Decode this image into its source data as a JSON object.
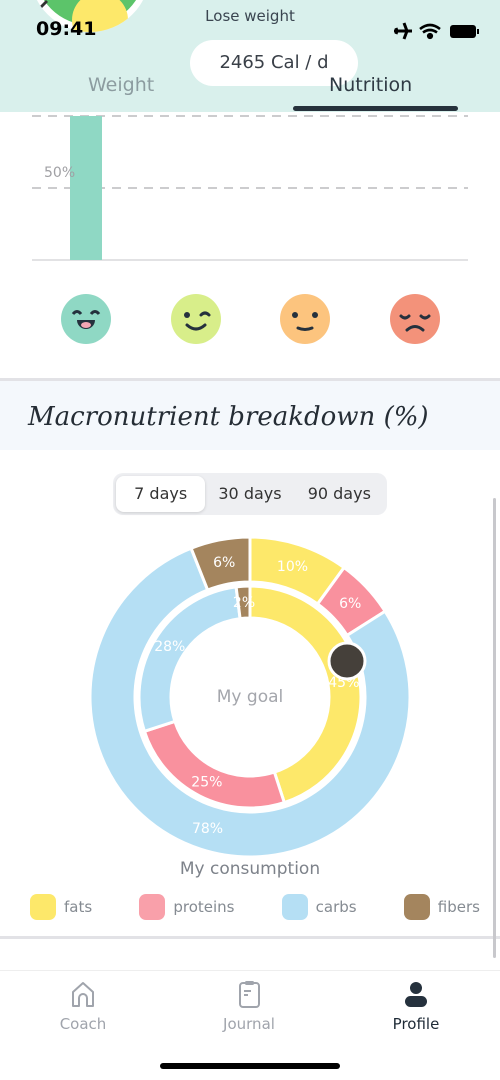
{
  "status": {
    "time": "09:41",
    "icons": [
      "airplane-icon",
      "wifi-icon",
      "battery-icon"
    ]
  },
  "header": {
    "goal": "Lose weight",
    "calories": "2465 Cal / d",
    "tabs": [
      {
        "label": "Weight",
        "active": false
      },
      {
        "label": "Nutrition",
        "active": true
      }
    ]
  },
  "mood_chart": {
    "type": "bar",
    "tick_label": "50%",
    "ylim": [
      0,
      100
    ],
    "categories": [
      "very-happy",
      "happy",
      "neutral",
      "sad"
    ],
    "values": [
      100,
      0,
      0,
      0
    ],
    "bar_color": "#8fd8c4",
    "face_colors": [
      "#8fd8c4",
      "#d8ee8a",
      "#fcc47e",
      "#f3927a"
    ]
  },
  "macro": {
    "title": "Macronutrient breakdown (%)",
    "ranges": [
      {
        "label": "7 days",
        "active": true
      },
      {
        "label": "30 days",
        "active": false
      },
      {
        "label": "90 days",
        "active": false
      }
    ],
    "inner_label": "My goal",
    "outer_label": "My consumption",
    "chart_data": {
      "type": "pie",
      "categories": [
        "fats",
        "proteins",
        "carbs",
        "fibers"
      ],
      "colors": [
        "#fde86a",
        "#f9919e",
        "#b5dff4",
        "#a4855e"
      ],
      "series": [
        {
          "name": "My consumption",
          "values": [
            10,
            6,
            78,
            6
          ]
        },
        {
          "name": "My goal",
          "values": [
            45,
            25,
            28,
            2
          ]
        }
      ]
    },
    "legend": [
      "fats",
      "proteins",
      "carbs",
      "fibers"
    ]
  },
  "nav": [
    {
      "label": "Coach",
      "icon": "home-icon",
      "active": false
    },
    {
      "label": "Journal",
      "icon": "clipboard-icon",
      "active": false
    },
    {
      "label": "Profile",
      "icon": "person-icon",
      "active": true
    }
  ]
}
